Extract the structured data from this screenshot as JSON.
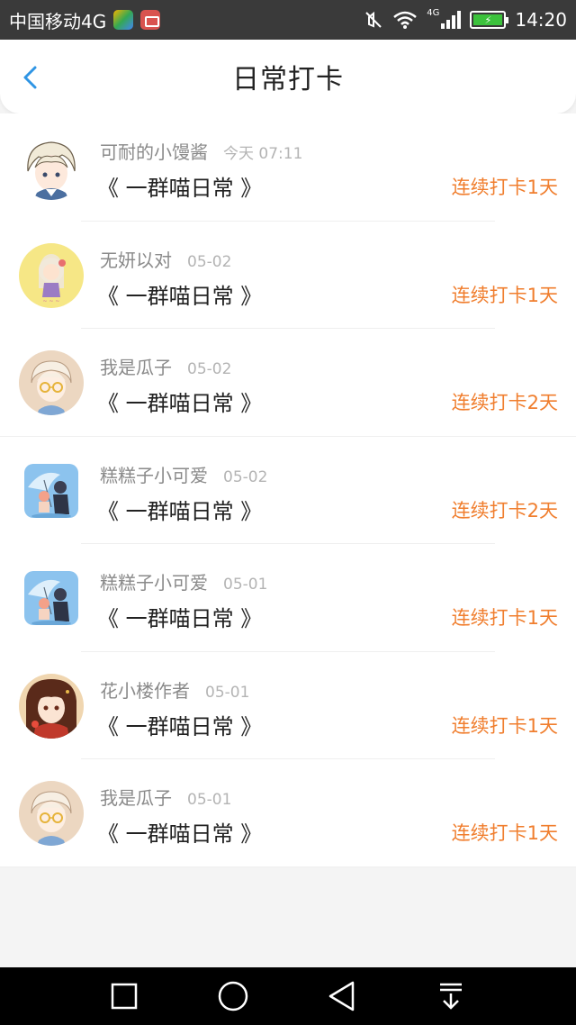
{
  "status_bar": {
    "carrier": "中国移动4G",
    "network": "4G",
    "time": "14:20",
    "icons": [
      "photos-app-icon",
      "mail-app-icon",
      "mute-icon",
      "wifi-icon",
      "signal-icon",
      "battery-charging-icon"
    ]
  },
  "header": {
    "title": "日常打卡",
    "back_icon": "chevron-left-icon"
  },
  "entries": [
    {
      "name": "可耐的小馒酱",
      "time": "今天 07:11",
      "book": "《 一群喵日常 》",
      "streak": "连续打卡1天",
      "avatar": "white-hair-boy"
    },
    {
      "name": "无妍以对",
      "time": "05-02",
      "book": "《 一群喵日常 》",
      "streak": "连续打卡1天",
      "avatar": "yellow-christmas-girl"
    },
    {
      "name": "我是瓜子",
      "time": "05-02",
      "book": "《 一群喵日常 》",
      "streak": "连续打卡2天",
      "avatar": "glasses-boy"
    },
    {
      "name": "糕糕子小可爱",
      "time": "05-02",
      "book": "《 一群喵日常 》",
      "streak": "连续打卡2天",
      "avatar": "umbrella-couple"
    },
    {
      "name": "糕糕子小可爱",
      "time": "05-01",
      "book": "《 一群喵日常 》",
      "streak": "连续打卡1天",
      "avatar": "umbrella-couple"
    },
    {
      "name": "花小楼作者",
      "time": "05-01",
      "book": "《 一群喵日常 》",
      "streak": "连续打卡1天",
      "avatar": "red-dress-girl"
    },
    {
      "name": "我是瓜子",
      "time": "05-01",
      "book": "《 一群喵日常 》",
      "streak": "连续打卡1天",
      "avatar": "glasses-boy"
    }
  ],
  "nav_bar": {
    "buttons": [
      "recent-apps-icon",
      "home-icon",
      "back-icon",
      "notification-pull-icon"
    ]
  },
  "colors": {
    "accent_orange": "#f07e2e",
    "back_blue": "#2f95e4",
    "status_bar": "#3a3a3a"
  }
}
